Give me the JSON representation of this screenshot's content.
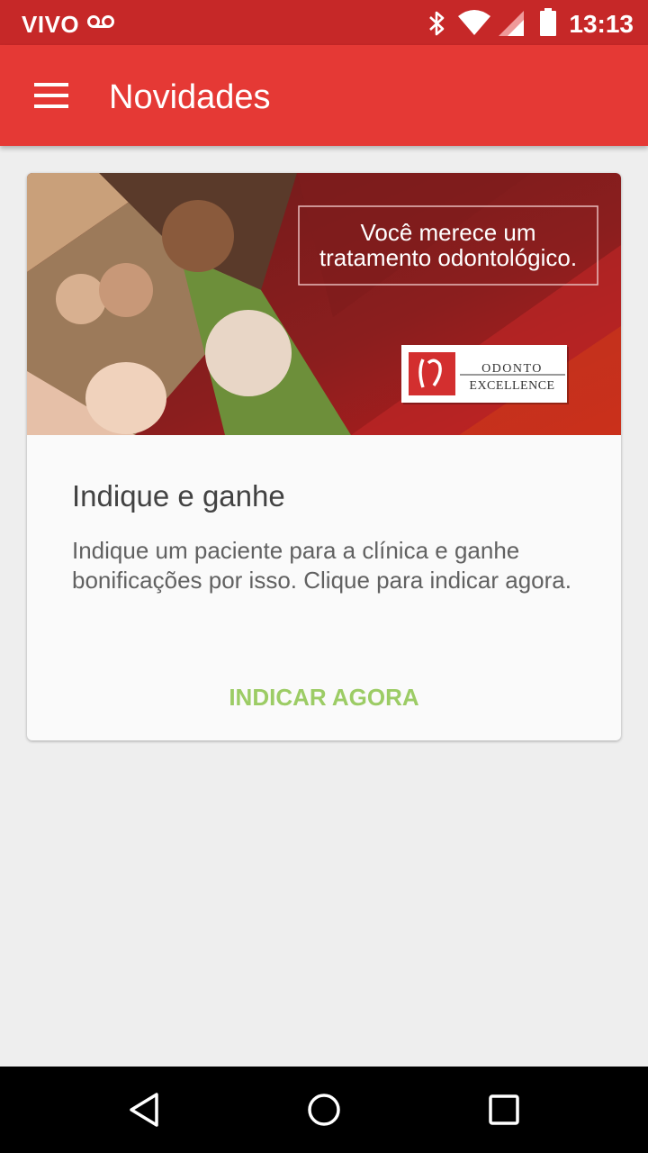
{
  "status_bar": {
    "carrier": "VIVO",
    "time": "13:13",
    "icons": [
      "voicemail-icon",
      "bluetooth-icon",
      "wifi-icon",
      "signal-icon",
      "battery-icon"
    ]
  },
  "app_bar": {
    "title": "Novidades",
    "menu_icon": "hamburger-menu-icon",
    "color": "#e53935"
  },
  "card": {
    "banner": {
      "slogan_line1": "Você merece um",
      "slogan_line2": "tratamento odontológico.",
      "logo_line1": "ODONTO",
      "logo_line2": "EXCELLENCE"
    },
    "headline": "Indique e ganhe",
    "body": "Indique um paciente para a clínica e ganhe bonificações por isso. Clique para indicar agora.",
    "action_label": "INDICAR AGORA",
    "action_color": "#9ccc65"
  },
  "nav_bar": {
    "icons": [
      "back-icon",
      "home-icon",
      "recents-icon"
    ]
  }
}
